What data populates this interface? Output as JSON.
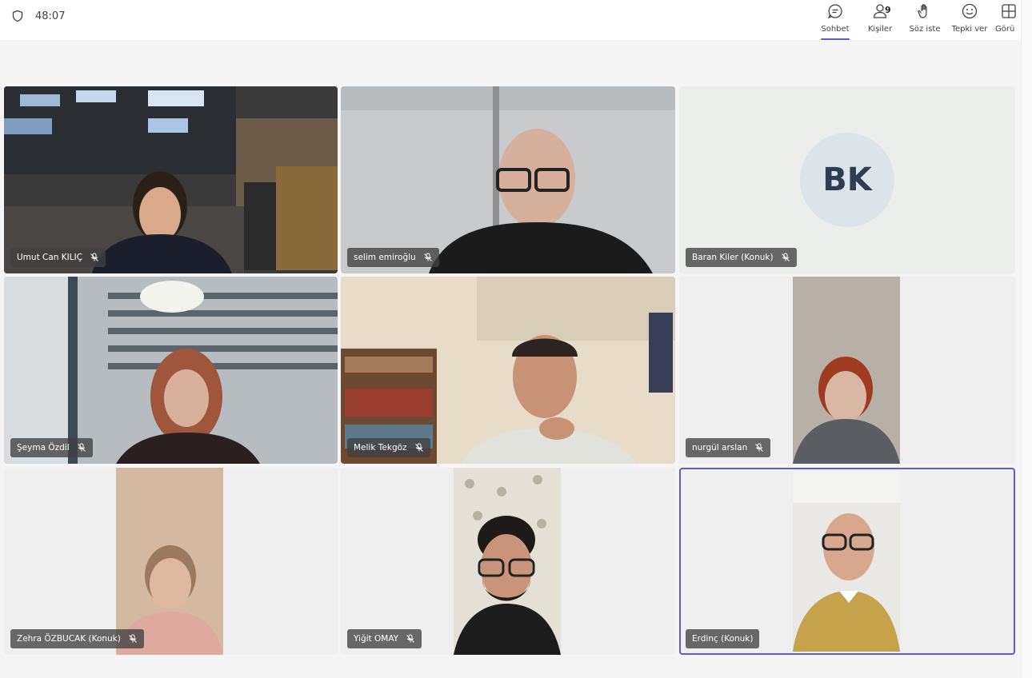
{
  "header": {
    "timer": "48:07",
    "actions": [
      {
        "label": "Sohbet",
        "icon": "chat-icon",
        "active": true
      },
      {
        "label": "Kişiler",
        "icon": "people-icon",
        "count": "9"
      },
      {
        "label": "Söz iste",
        "icon": "raise-hand-icon"
      },
      {
        "label": "Tepki ver",
        "icon": "react-icon"
      },
      {
        "label": "Görü",
        "icon": "view-icon"
      }
    ]
  },
  "participants": [
    {
      "name": "Umut Can KILIÇ",
      "muted": true
    },
    {
      "name": "selim emiroğlu",
      "muted": true
    },
    {
      "name": "Baran Kiler (Konuk)",
      "muted": true,
      "initials": "BK"
    },
    {
      "name": "Şeyma Özdil",
      "muted": true
    },
    {
      "name": "Melik Tekgöz",
      "muted": true
    },
    {
      "name": "nurgül arslan",
      "muted": true
    },
    {
      "name": "Zehra ÖZBUCAK (Konuk)",
      "muted": true
    },
    {
      "name": "Yiğit OMAY",
      "muted": true
    },
    {
      "name": "Erdinç (Konuk)",
      "muted": false,
      "speaking": true
    }
  ],
  "colors": {
    "accent": "#5b5fc7",
    "avatar_bg": "#dce3e9",
    "name_tag_bg": "#404040"
  }
}
